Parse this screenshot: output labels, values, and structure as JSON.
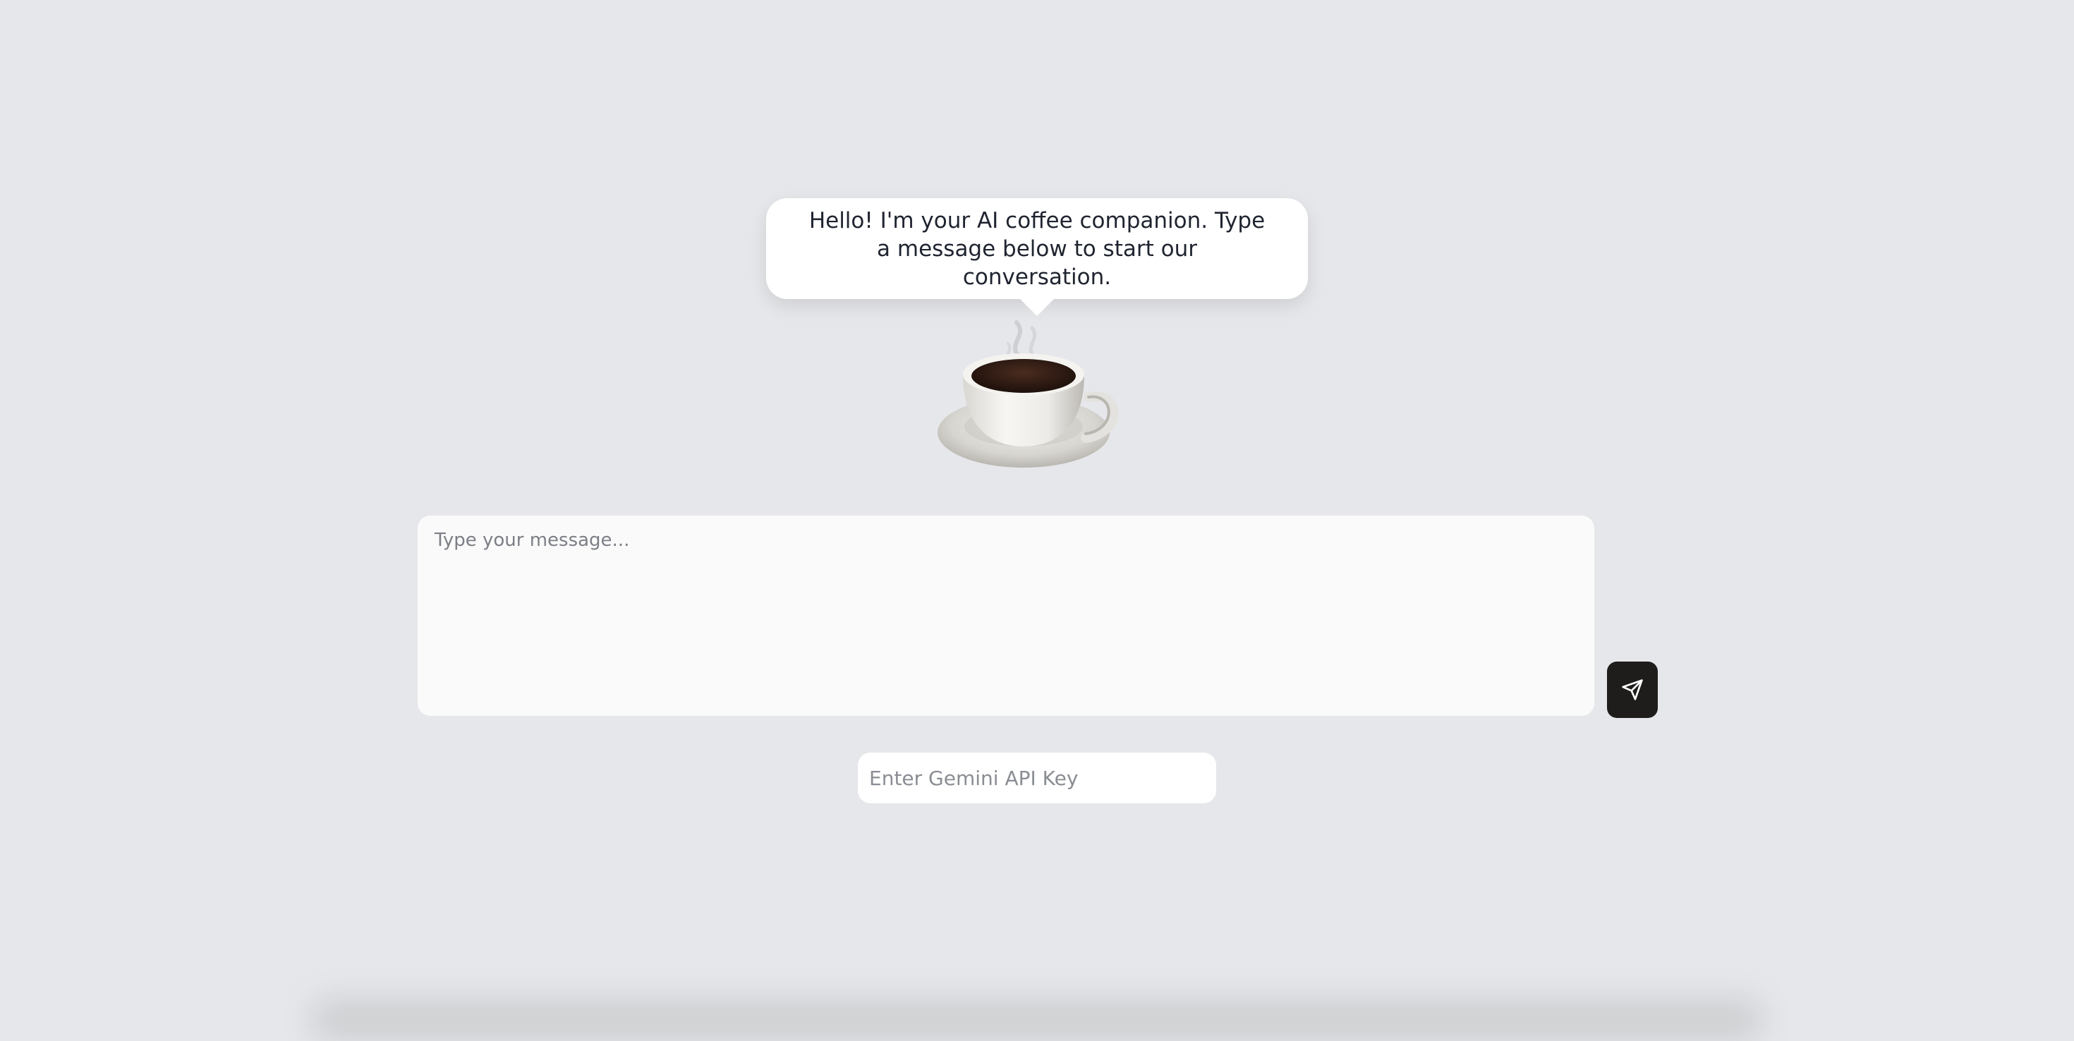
{
  "greeting": {
    "text": "Hello! I'm your AI coffee companion. Type a message below to start our conversation."
  },
  "mascot": {
    "icon": "coffee-cup-icon"
  },
  "chat": {
    "message_placeholder": "Type your message...",
    "send_icon": "paper-plane-icon"
  },
  "api_key": {
    "placeholder": "Enter Gemini API Key"
  },
  "colors": {
    "background": "#e6e7ea",
    "send_button": "#1e1d1c",
    "coffee": "#3a2218"
  }
}
